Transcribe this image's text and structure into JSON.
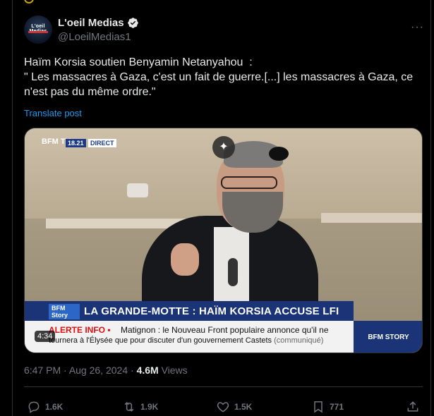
{
  "author": {
    "name": "L'oeil Medias",
    "handle": "@LoeilMedias1",
    "avatar_text": "L'oeil Medias"
  },
  "post": {
    "line1": "Haïm Korsia soutien Benyamin Netanyahou  :",
    "line2": "\" Les massacres à Gaza, c'est un fait de guerre.[...] les massacres à Gaza, ce n'est pas du même ordre.\"",
    "translate_label": "Translate post"
  },
  "video": {
    "channel_logo": "BFM TV.",
    "time": "18.21",
    "live": "DIRECT",
    "lower_tag": "BFM Story",
    "headline": "LA GRANDE-MOTTE : HAÏM KORSIA ACCUSE LFI",
    "alert_label": "ALERTE INFO",
    "ticker_line1": "Matignon : le Nouveau Front populaire annonce qu'il ne",
    "ticker_line2": "tournera à l'Élysée que pour discuter d'un gouvernement Castets",
    "ticker_note": "(communiqué)",
    "story_label": "BFM STORY",
    "duration": "4:34"
  },
  "meta": {
    "time": "6:47 PM",
    "separator": " · ",
    "date": "Aug 26, 2024",
    "views_count": "4.6M",
    "views_label": "Views"
  },
  "actions": {
    "replies": "1.6K",
    "reposts": "1.9K",
    "likes": "1.5K",
    "bookmarks": "771"
  },
  "colors": {
    "accent": "#1d9bf0",
    "muted": "#71767b",
    "text": "#e7e9ea",
    "background": "#000000"
  },
  "icons": [
    "verified-badge-icon",
    "more-icon",
    "sparkle-icon",
    "reply-icon",
    "repost-icon",
    "like-icon",
    "bookmark-icon",
    "share-icon"
  ]
}
